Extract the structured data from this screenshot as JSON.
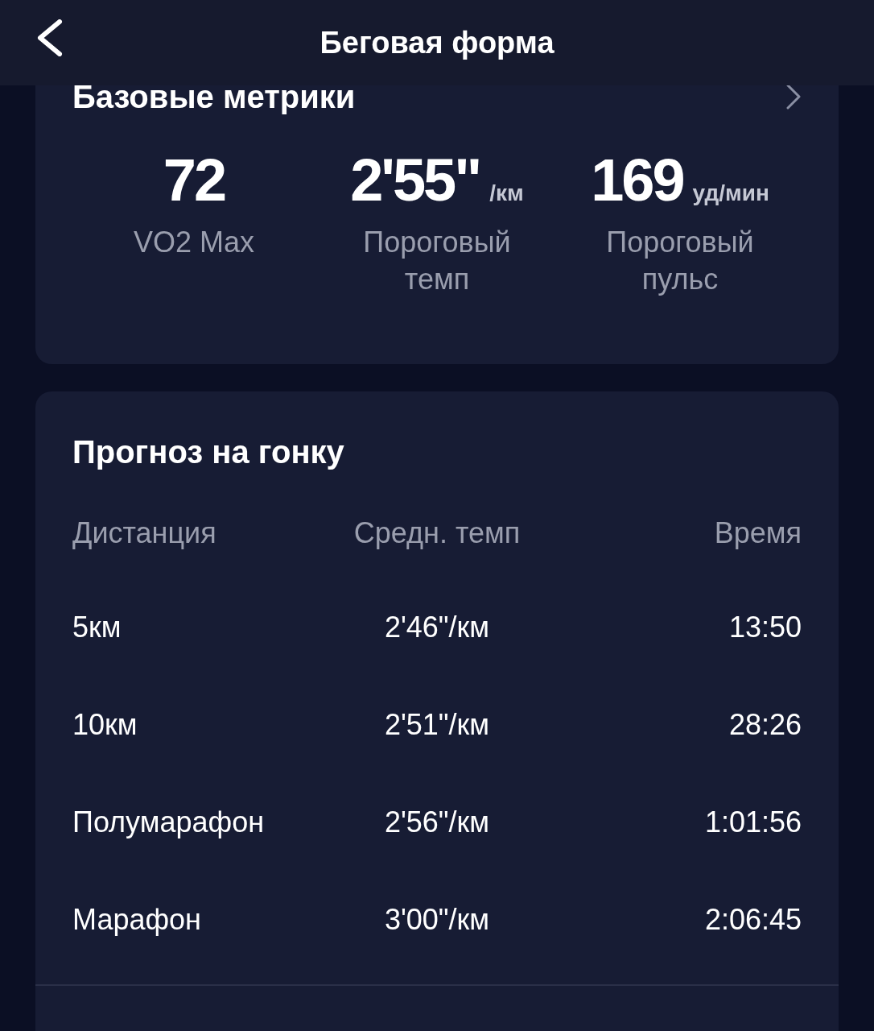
{
  "header": {
    "title": "Беговая форма"
  },
  "base_metrics": {
    "title": "Базовые метрики",
    "metrics": [
      {
        "value": "72",
        "label": "VO2 Max"
      },
      {
        "value": "2'55\"",
        "unit": "/км",
        "label": "Пороговый темп"
      },
      {
        "value": "169",
        "unit": "уд/мин",
        "label": "Пороговый пульс"
      }
    ]
  },
  "race_forecast": {
    "title": "Прогноз на гонку",
    "columns": [
      "Дистанция",
      "Средн. темп",
      "Время"
    ],
    "rows": [
      [
        "5км",
        "2'46\"/км",
        "13:50"
      ],
      [
        "10км",
        "2'51\"/км",
        "28:26"
      ],
      [
        "Полумарафон",
        "2'56\"/км",
        "1:01:56"
      ],
      [
        "Марафон",
        "3'00\"/км",
        "2:06:45"
      ]
    ]
  }
}
